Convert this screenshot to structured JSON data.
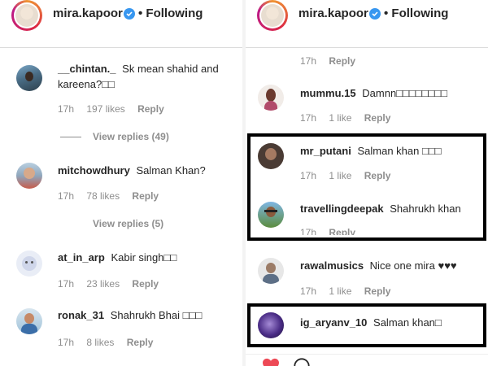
{
  "left": {
    "header": {
      "username": "mira.kapoor",
      "follow_status": "• Following"
    },
    "comments": [
      {
        "user": "__chintan._",
        "text": "Sk mean shahid and kareena?□□",
        "time": "17h",
        "likes": "197 likes",
        "reply": "Reply",
        "view_replies": "View replies (49)"
      },
      {
        "user": "mitchowdhury",
        "text": "Salman Khan?",
        "time": "17h",
        "likes": "78 likes",
        "reply": "Reply",
        "view_replies": "View replies (5)"
      },
      {
        "user": "at_in_arp",
        "text": "Kabir singh□□",
        "time": "17h",
        "likes": "23 likes",
        "reply": "Reply"
      },
      {
        "user": "ronak_31",
        "text": "Shahrukh Bhai □□□",
        "time": "17h",
        "likes": "8 likes",
        "reply": "Reply"
      }
    ]
  },
  "right": {
    "header": {
      "username": "mira.kapoor",
      "follow_status": "• Following"
    },
    "top_meta": {
      "time": "17h",
      "reply": "Reply"
    },
    "comments": [
      {
        "user": "mummu.15",
        "text": "Damnn□□□□□□□□",
        "time": "17h",
        "likes": "1 like",
        "reply": "Reply"
      },
      {
        "user": "mr_putani",
        "text": "Salman khan □□□",
        "time": "17h",
        "likes": "1 like",
        "reply": "Reply"
      },
      {
        "user": "travellingdeepak",
        "text": "Shahrukh khan",
        "time": "17h",
        "reply": "Reply"
      },
      {
        "user": "rawalmusics",
        "text": "Nice one mira ♥♥♥",
        "time": "17h",
        "likes": "1 like",
        "reply": "Reply"
      },
      {
        "user": "ig_aryanv_10",
        "text": "Salman khan□"
      }
    ]
  },
  "colors": {
    "highlight_border": "#000000",
    "verified": "#3897f0",
    "like_heart": "#ed4956"
  },
  "icons": [
    "verified-badge-icon",
    "heart-icon",
    "comment-icon"
  ]
}
